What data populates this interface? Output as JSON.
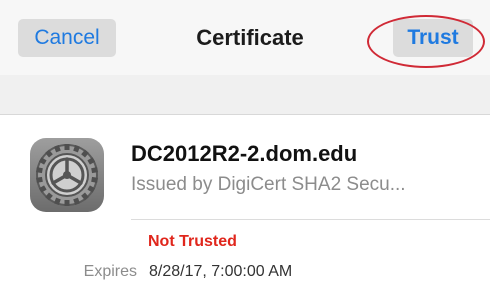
{
  "navbar": {
    "cancel_label": "Cancel",
    "title": "Certificate",
    "trust_label": "Trust"
  },
  "certificate": {
    "icon": "settings-gear-icon",
    "name": "DC2012R2-2.dom.edu",
    "issuer": "Issued by DigiCert SHA2 Secu...",
    "status": "Not Trusted",
    "expires_label": "Expires",
    "expires_value": "8/28/17, 7:00:00 AM"
  },
  "colors": {
    "accent": "#1f7ae0",
    "status_red": "#e0261c",
    "annotation_circle": "#d02a36"
  }
}
